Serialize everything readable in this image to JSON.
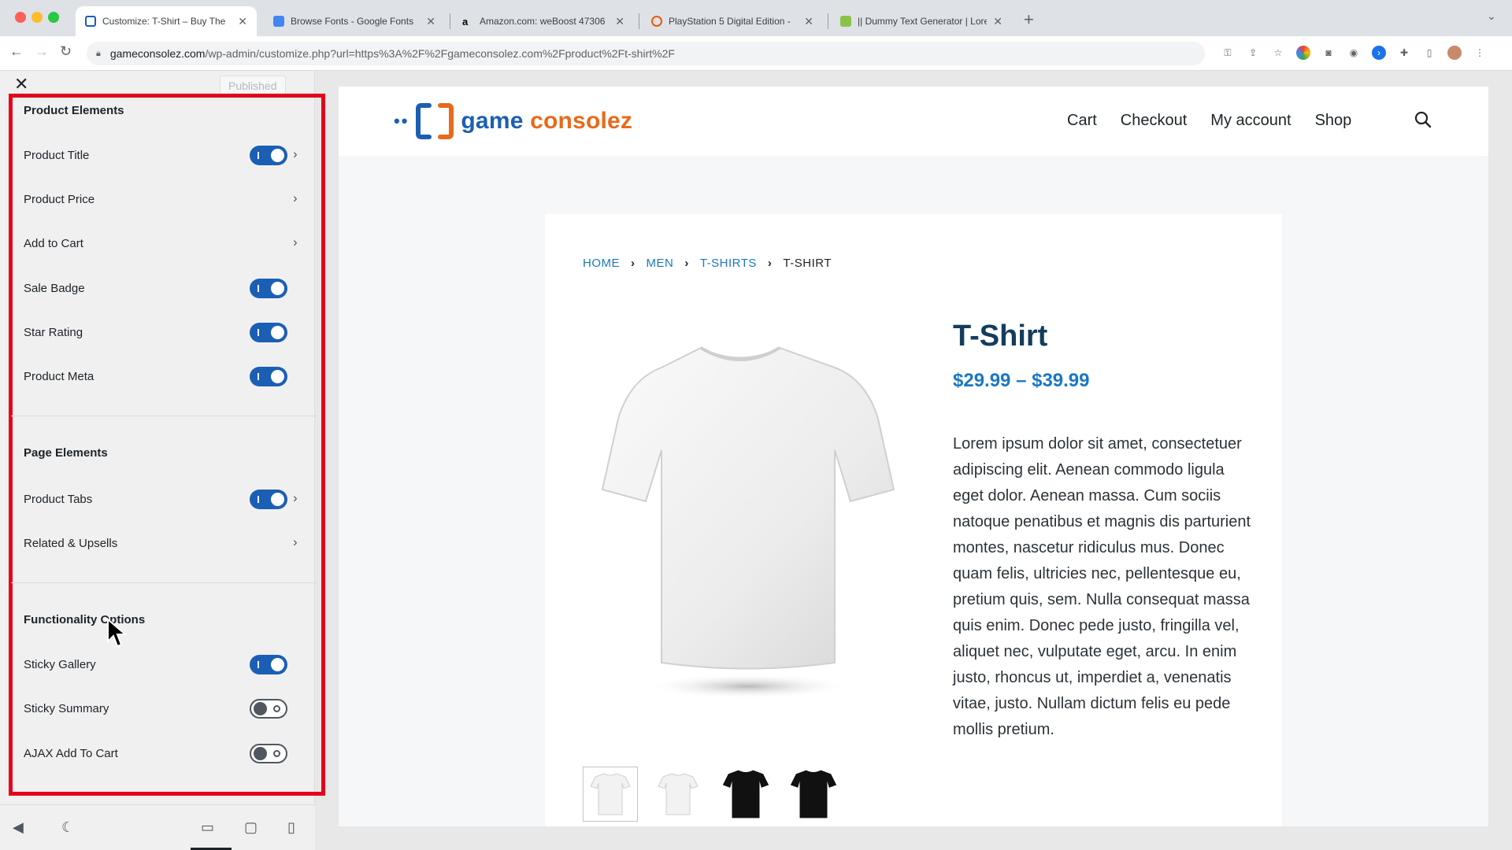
{
  "browser": {
    "tabs": [
      {
        "title": "Customize: T-Shirt – Buy The",
        "fav_color": "#ffffff",
        "active": true
      },
      {
        "title": "Browse Fonts - Google Fonts",
        "fav_color": "#4285f4",
        "active": false
      },
      {
        "title": "Amazon.com: weBoost 47306",
        "fav_color": "#ffffff",
        "active": false
      },
      {
        "title": "PlayStation 5 Digital Edition - ",
        "fav_color": "#e8590c",
        "active": false
      },
      {
        "title": "|| Dummy Text Generator | Lore",
        "fav_color": "#8bc34a",
        "active": false
      }
    ],
    "url_host": "gameconsolez.com",
    "url_path": "/wp-admin/customize.php?url=https%3A%2F%2Fgameconsolez.com%2Fproduct%2Ft-shirt%2F"
  },
  "customizer": {
    "published_label": "Published",
    "sections": [
      {
        "title": "Product Elements"
      },
      {
        "title": "Page Elements"
      },
      {
        "title": "Functionality Options"
      }
    ],
    "rows": [
      {
        "label": "Product Title",
        "toggle": "on",
        "chevron": true
      },
      {
        "label": "Product Price",
        "toggle": "none",
        "chevron": true
      },
      {
        "label": "Add to Cart",
        "toggle": "none",
        "chevron": true
      },
      {
        "label": "Sale Badge",
        "toggle": "on",
        "chevron": false
      },
      {
        "label": "Star Rating",
        "toggle": "on",
        "chevron": false
      },
      {
        "label": "Product Meta",
        "toggle": "on",
        "chevron": false
      },
      {
        "label": "Product Tabs",
        "toggle": "on",
        "chevron": true
      },
      {
        "label": "Related & Upsells",
        "toggle": "none",
        "chevron": true
      },
      {
        "label": "Sticky Gallery",
        "toggle": "on",
        "chevron": false
      },
      {
        "label": "Sticky Summary",
        "toggle": "off",
        "chevron": false
      },
      {
        "label": "AJAX Add To Cart",
        "toggle": "off",
        "chevron": false
      }
    ],
    "footer_icons": [
      "back-icon",
      "dark-mode-icon",
      "desktop-icon",
      "tablet-icon",
      "mobile-icon"
    ],
    "highlight_color": "#e3061a"
  },
  "site": {
    "logo_word1": "game",
    "logo_word2": "consolez",
    "nav": [
      "Cart",
      "Checkout",
      "My account",
      "Shop"
    ],
    "breadcrumbs": [
      "HOME",
      "MEN",
      "T-SHIRTS",
      "T-SHIRT"
    ],
    "product": {
      "title": "T-Shirt",
      "price": "$29.99 – $39.99",
      "description": "Lorem ipsum dolor sit amet, consectetuer adipiscing elit. Aenean commodo ligula eget dolor. Aenean massa. Cum sociis natoque penatibus et magnis dis parturient montes, nascetur ridiculus mus. Donec quam felis, ultricies nec, pellentesque eu, pretium quis, sem. Nulla consequat massa quis enim. Donec pede justo, fringilla vel, aliquet nec, vulputate eget, arcu. In enim justo, rhoncus ut, imperdiet a, venenatis vitae, justo. Nullam dictum felis eu pede mollis pretium.",
      "thumbnails": [
        "white",
        "white",
        "black",
        "black"
      ]
    },
    "colors": {
      "brand_blue": "#1a5fb4",
      "brand_orange": "#e86a1b",
      "link_blue": "#1a78c2"
    }
  }
}
